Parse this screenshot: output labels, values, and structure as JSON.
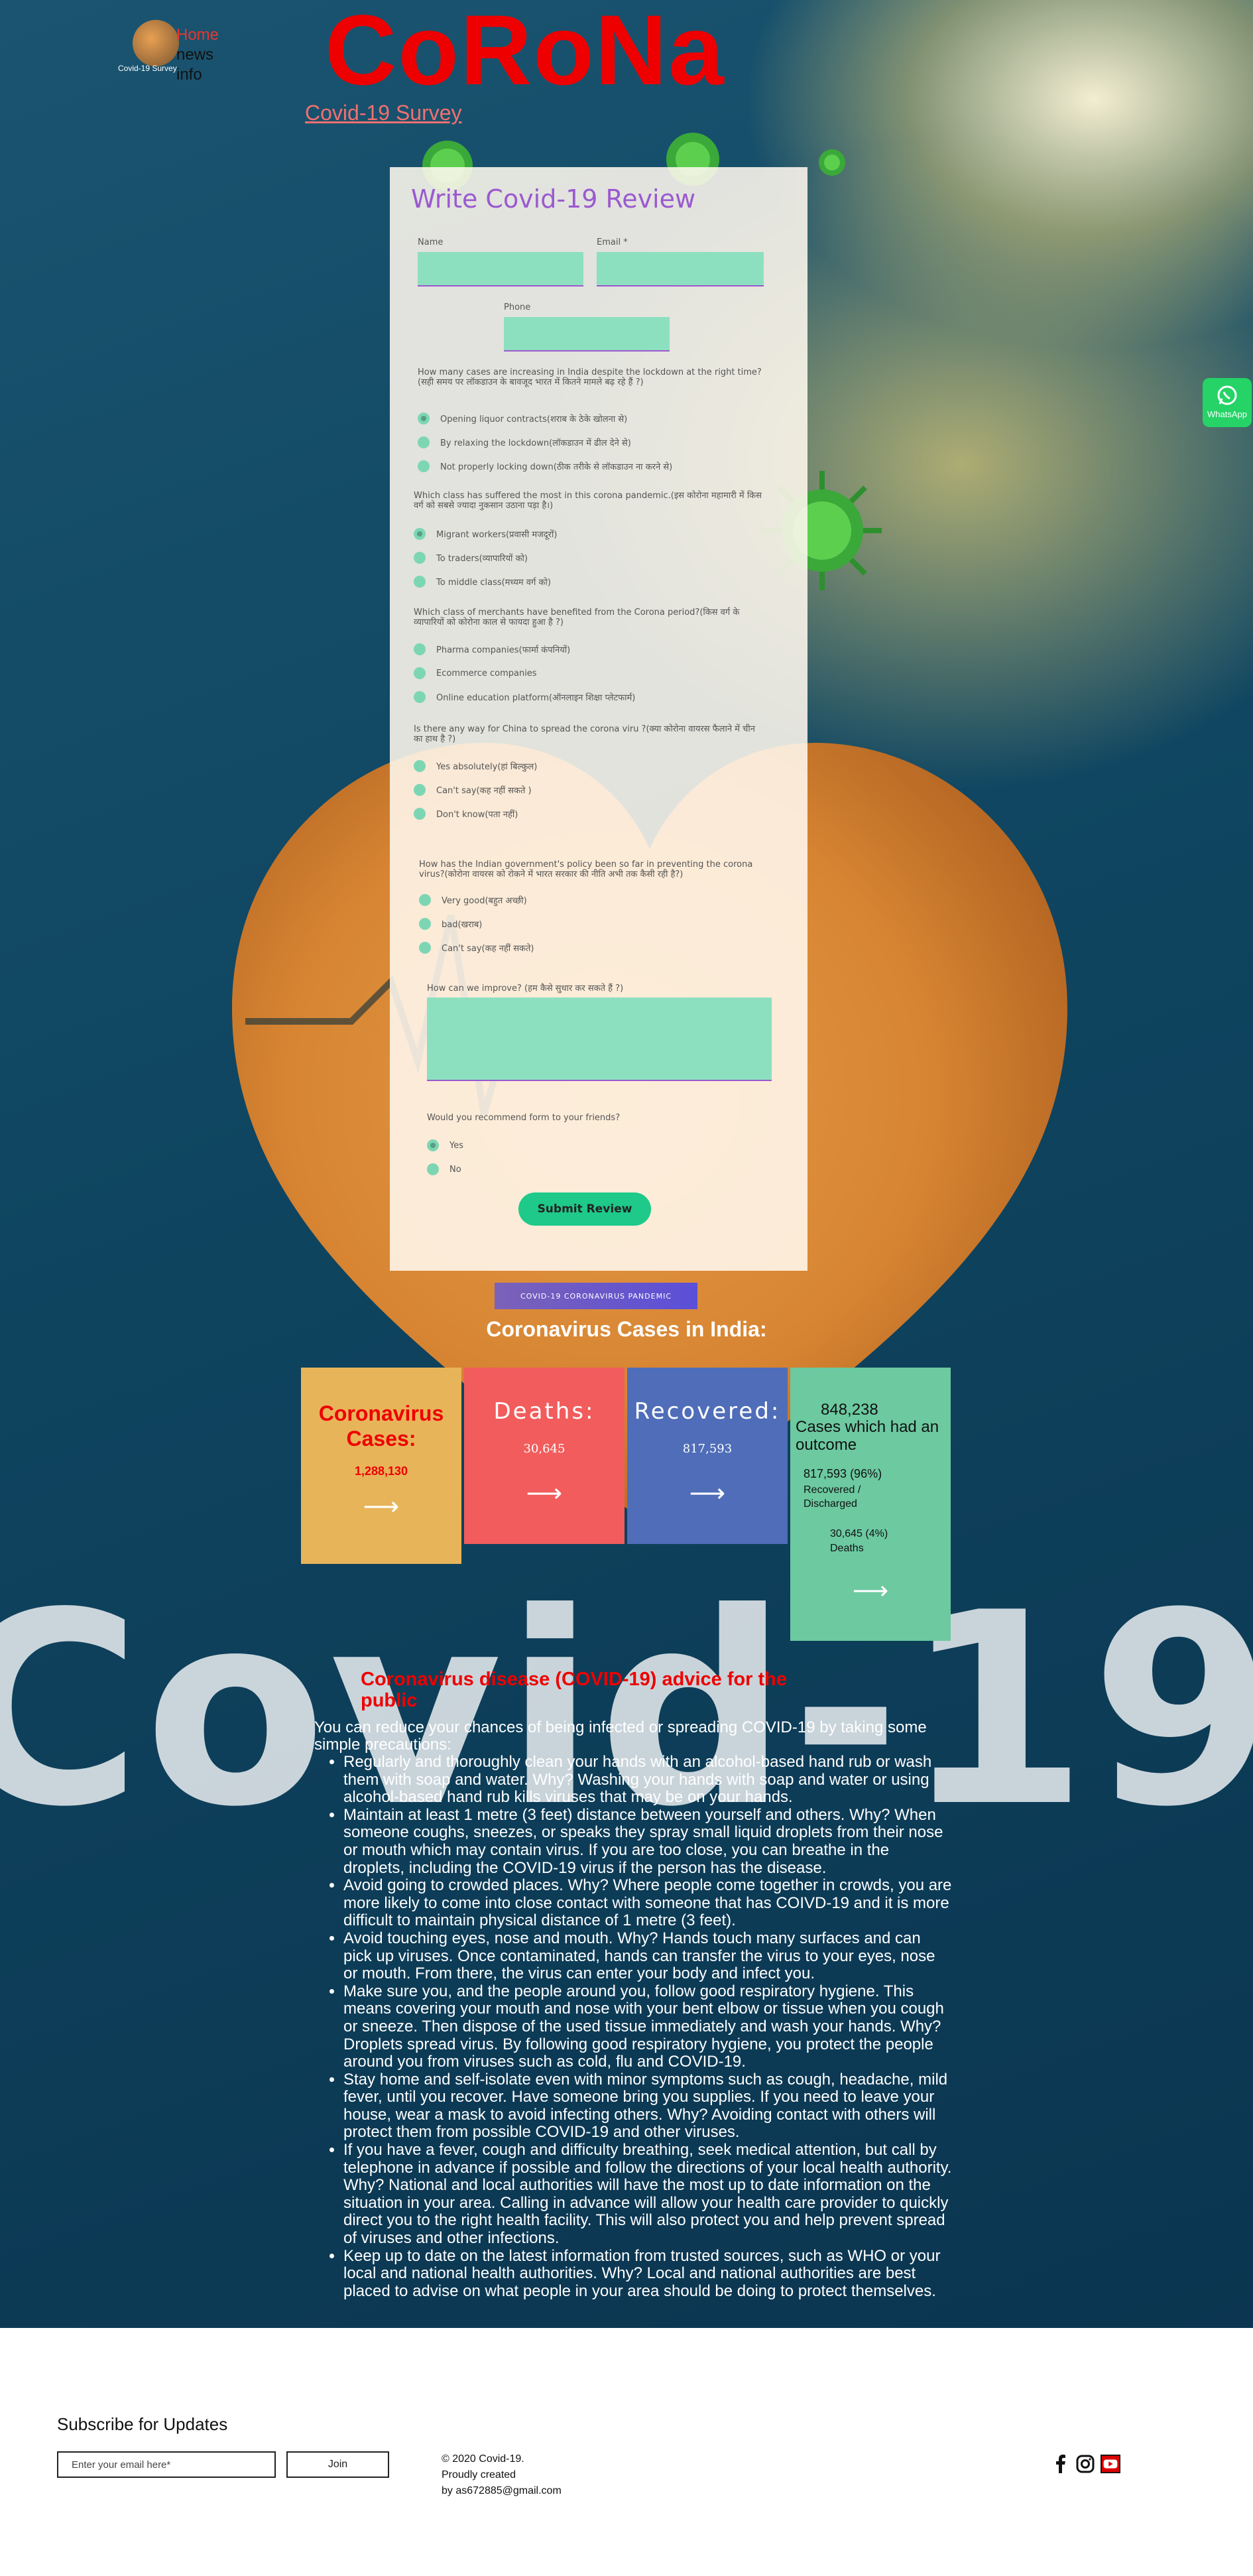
{
  "nav": {
    "logo_text": "Covid-19 Survey",
    "items": [
      "Home",
      "news",
      "info"
    ]
  },
  "brand": "CoRoNa",
  "survey_link": "Covid-19 Survey",
  "watermark": "Covid-19 Survey",
  "form": {
    "title": "Write Covid-19 Review",
    "name_label": "Name",
    "email_label": "Email *",
    "phone_label": "Phone",
    "questions": [
      {
        "text": "How many cases are increasing in India despite the lockdown at the right time?(सही समय पर लॉकडाउन के बावजूद भारत में कितने मामले बढ़ रहे हैं ?)",
        "options": [
          "Opening liquor contracts(शराब के ठेके खोलना से)",
          "By relaxing the lockdown(लॉकडाउन में ढील देने से)",
          "Not properly locking down(ठीक तरीके से लॉकडाउन ना करने से)"
        ],
        "selected": 0
      },
      {
        "text": "Which class has suffered the most in this corona pandemic.(इस कोरोना महामारी में किस वर्ग को सबसे ज्यादा नुकसान उठाना पड़ा है।)",
        "options": [
          "Migrant workers(प्रवासी मजदूरों)",
          "To traders(व्यापारियों को)",
          "To middle class(मध्यम वर्ग को)"
        ],
        "selected": 0
      },
      {
        "text": "Which class of merchants have benefited from the Corona period?(किस वर्ग के व्यापारियों को कोरोना काल से फायदा हुआ है ?)",
        "options": [
          "Pharma companies(फार्मा कंपनियों)",
          "Ecommerce companies",
          "Online education platform(ऑनलाइन शिक्षा प्लेटफार्म)"
        ],
        "selected": -1
      },
      {
        "text": "Is there any way for China to spread the corona viru ?(क्या कोरोना वायरस फैलाने में चीन का हाथ है ?)",
        "options": [
          "Yes absolutely(हां बिल्कुल)",
          "Can't say(कह नहीं सकते )",
          "Don't know(पता नहीं)"
        ],
        "selected": -1
      },
      {
        "text": "How has the Indian government's policy been so far in preventing the corona virus?(कोरोना वायरस को रोकने में भारत सरकार की नीति अभी तक कैसी रही है?)",
        "options": [
          "Very good(बहुत अच्छी)",
          "bad(खराब)",
          "Can't say(कह नहीं सकते)"
        ],
        "selected": -1
      }
    ],
    "improve_label": "How can we improve? (हम कैसे सुधार कर सकते हैं ?)",
    "recommend_label": "Would you recommend form to your friends?",
    "recommend_options": [
      "Yes",
      "No"
    ],
    "recommend_selected": 0,
    "submit_label": "Submit Review"
  },
  "pandemic_button": "COVID-19 CORONAVIRUS PANDEMIC",
  "cases": {
    "heading": "Coronavirus Cases in India:",
    "cards": [
      {
        "title": "Coronavirus Cases:",
        "value": "1,288,130",
        "color": "#e8b45a"
      },
      {
        "title": "Deaths:",
        "value": "30,645",
        "color": "#f25c5c"
      },
      {
        "title": "Recovered:",
        "value": "817,593",
        "color": "#4f6db8"
      }
    ],
    "outcome": {
      "total": "848,238",
      "caption": "Cases which had an outcome",
      "recovered_value": "817,593 (96%)",
      "recovered_label": "Recovered / Discharged",
      "deaths_value": "30,645 (4%)",
      "deaths_label": "Deaths",
      "color": "#6cc9a0"
    },
    "arrow": "⟶"
  },
  "advice": {
    "title": "Coronavirus disease (COVID-19) advice for the public",
    "intro": "You can reduce your chances of being infected or spreading COVID-19 by taking some simple precautions:",
    "items": [
      "Regularly and thoroughly clean your hands with an alcohol-based hand rub or wash them with soap and water. Why? Washing your hands with soap and water or using alcohol-based hand rub kills viruses that may be on your hands.",
      "Maintain at least 1 metre (3 feet) distance between yourself and others. Why? When someone coughs, sneezes, or speaks they spray small liquid droplets from their nose or mouth which may contain virus. If you are too close, you can breathe in the droplets, including the COVID-19 virus if the person has the disease.",
      "Avoid going to crowded places. Why? Where people come together in crowds, you are more likely to come into close contact with someone that has COIVD-19 and it is more difficult to maintain physical distance of 1 metre (3 feet).",
      "Avoid touching eyes, nose and mouth. Why? Hands touch many surfaces and can pick up viruses. Once contaminated, hands can transfer the virus to your eyes, nose or mouth. From there, the virus can enter your body and infect you.",
      "Make sure you, and the people around you, follow good respiratory hygiene. This means covering your mouth and nose with your bent elbow or tissue when you cough or sneeze. Then dispose of the used tissue immediately and wash your hands. Why? Droplets spread virus. By following good respiratory hygiene, you protect the people around you from viruses such as cold, flu and COVID-19.",
      "Stay home and self-isolate even with minor symptoms such as cough, headache, mild fever, until you recover. Have someone bring you supplies. If you need to leave your house, wear a mask to avoid infecting others. Why? Avoiding contact with others will protect them from possible COVID-19 and other viruses.",
      "If you have a fever, cough and difficulty breathing, seek medical attention, but call by telephone in advance if possible and follow the directions of your local health authority. Why? National and local authorities will have the most up to date information on the situation in your area. Calling in advance will allow your health care provider to quickly direct you to the right health facility. This will also protect you and help prevent spread of viruses and other infections.",
      "Keep up to date on the latest information from trusted sources, such as WHO or your local and national health authorities. Why? Local and national authorities are best placed to advise on what people in your area should be doing to protect themselves."
    ]
  },
  "footer": {
    "subscribe_title": "Subscribe for Updates",
    "email_placeholder": "Enter your email here*",
    "join_label": "Join",
    "copyright_1": "© 2020 Covid-19.",
    "copyright_2": "Proudly created",
    "copyright_3": "by as672885@gmail.com",
    "social": [
      "facebook-icon",
      "instagram-icon",
      "youtube-icon"
    ]
  },
  "whatsapp_label": "WhatsApp"
}
